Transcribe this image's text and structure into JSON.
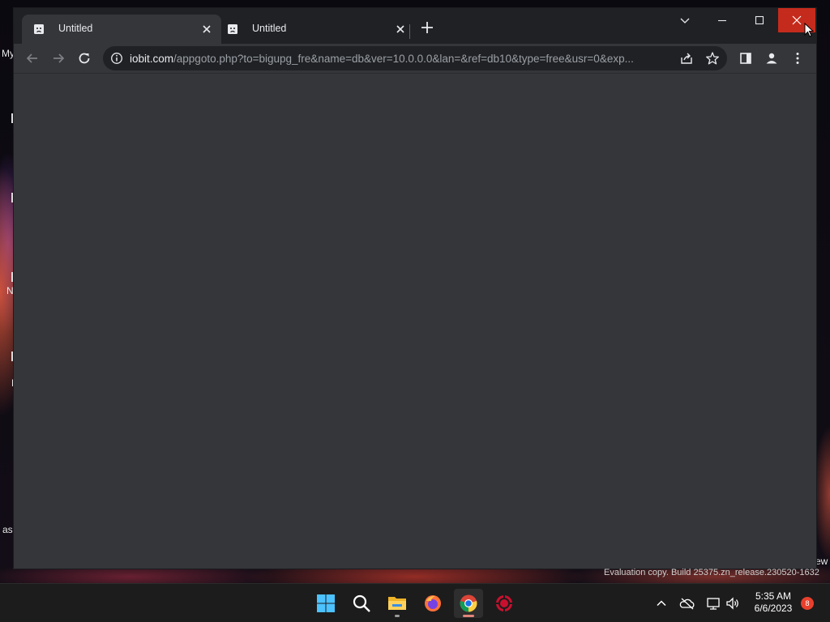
{
  "browser": {
    "tabs": [
      {
        "label": "Untitled",
        "icon": "sad-page-icon",
        "active": true
      },
      {
        "label": "Untitled",
        "icon": "sad-page-icon",
        "active": false
      }
    ],
    "new_tab_icon": "plus-icon",
    "window_controls": [
      "tab-search-icon",
      "minimize-icon",
      "maximize-icon",
      "close-icon"
    ],
    "toolbar": {
      "back_icon": "arrow-left-icon",
      "forward_icon": "arrow-right-icon",
      "reload_icon": "reload-icon",
      "omnibox": {
        "security_icon": "info-icon",
        "url_host": "iobit.com",
        "url_rest": "/appgoto.php?to=bigupg_fre&name=db&ver=10.0.0.0&lan=&ref=db10&type=free&usr=0&exp...",
        "share_icon": "share-icon",
        "bookmark_icon": "star-icon"
      },
      "side_panel_icon": "side-panel-icon",
      "profile_icon": "profile-icon",
      "menu_icon": "kebab-menu-icon"
    },
    "content": ""
  },
  "desktop": {
    "fragments": [
      "My",
      "N",
      "L",
      "asc",
      "ew"
    ]
  },
  "watermark": "Evaluation copy. Build 25375.zn_release.230520-1632",
  "taskbar": {
    "apps": [
      "windows-start-icon",
      "search-icon",
      "file-explorer-icon",
      "firefox-icon",
      "chrome-icon",
      "iobit-icon"
    ],
    "active_app": "chrome-icon",
    "tray": [
      "chevron-up-icon",
      "onedrive-icon",
      "network-icon",
      "volume-icon"
    ],
    "time": "5:35 AM",
    "date": "6/6/2023",
    "notification_count": "8"
  },
  "colors": {
    "tabstrip": "#202124",
    "toolbar": "#35363a",
    "omnibox": "#202124",
    "close_hover": "#c42b1c",
    "notification_badge": "#e8402c"
  }
}
